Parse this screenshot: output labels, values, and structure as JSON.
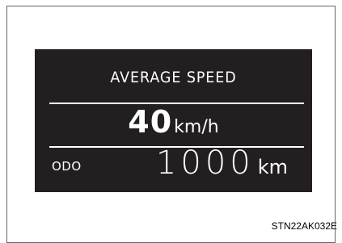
{
  "display": {
    "title": "AVERAGE SPEED",
    "speed_value": "40",
    "speed_unit": "km/h",
    "odo_label": "ODO",
    "odo_value": "1000",
    "odo_unit": "km"
  },
  "figure_code": "STN22AK032E",
  "colors": {
    "screen_background": "#231f20",
    "screen_text": "#ffffff",
    "page_background": "#ffffff",
    "frame_border": "#666666"
  }
}
